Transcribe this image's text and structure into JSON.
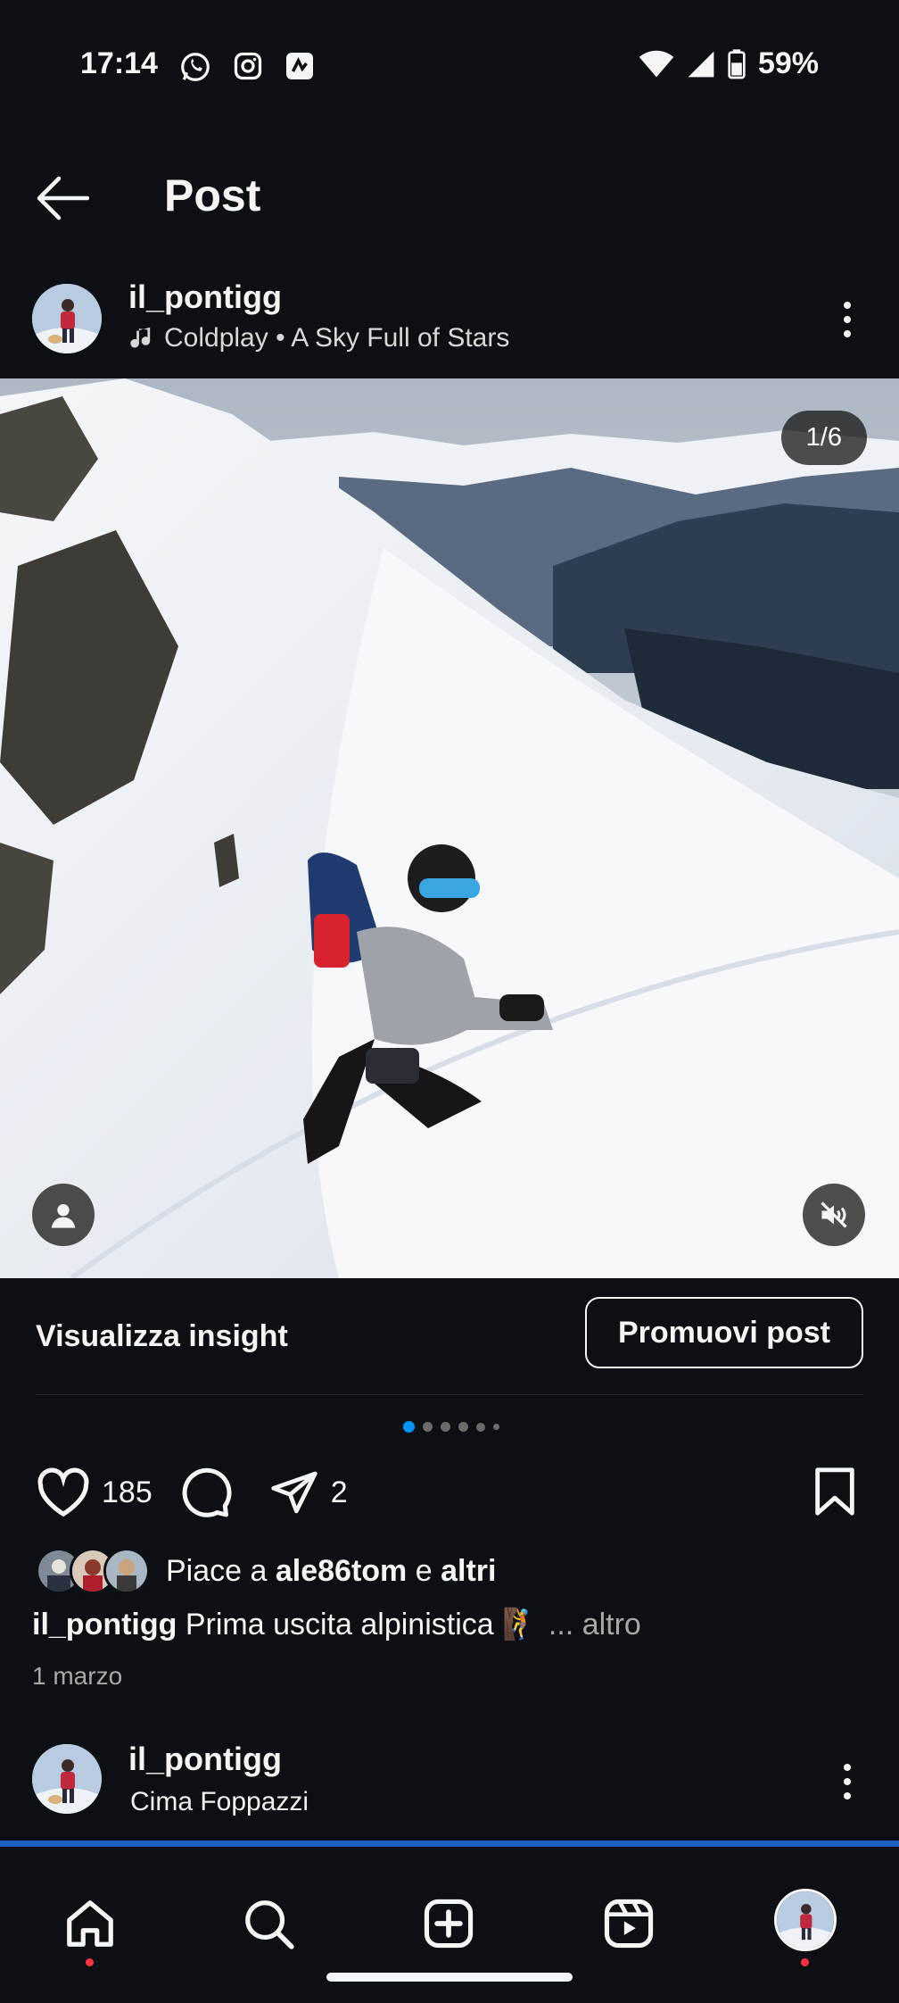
{
  "status_bar": {
    "time": "17:14",
    "battery": "59%"
  },
  "header": {
    "title": "Post"
  },
  "post": {
    "username": "il_pontigg",
    "music": "Coldplay • A Sky Full of Stars",
    "counter": "1/6",
    "carousel": {
      "total_dots": 6,
      "active_index": 0
    },
    "likes_count": "185",
    "shares_count": "2",
    "liked_by_prefix": "Piace a",
    "liked_by_user": "ale86tom",
    "liked_by_conj": "e",
    "liked_by_others": "altri",
    "caption_user": "il_pontigg",
    "caption_text": "Prima uscita alpinistica 🧗",
    "caption_more": "... altro",
    "date": "1 marzo"
  },
  "insights": {
    "label": "Visualizza insight",
    "promote_label": "Promuovi post"
  },
  "next_post": {
    "username": "il_pontigg",
    "location": "Cima Foppazzi"
  },
  "colors": {
    "background": "#0c1014",
    "accent": "#1e5fbf",
    "notification": "#ff3040"
  }
}
